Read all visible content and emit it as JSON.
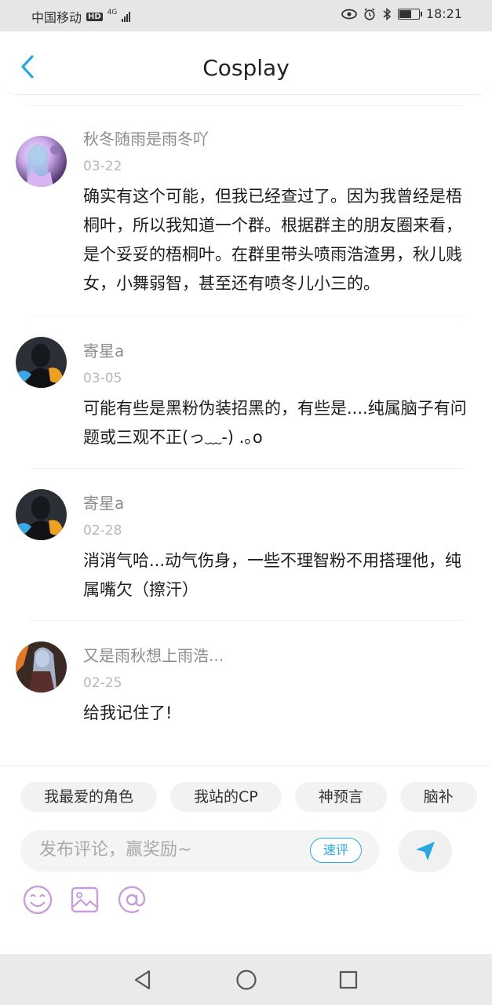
{
  "status_bar": {
    "carrier": "中国移动",
    "network_badge": "HD",
    "network_type": "4G",
    "time": "18:21",
    "battery_level": 0.6,
    "icons": [
      "eye-icon",
      "alarm-icon",
      "bluetooth-icon",
      "battery-icon"
    ]
  },
  "header": {
    "title": "Cosplay",
    "back_icon": "chevron-left-icon"
  },
  "comments": [
    {
      "user": "秋冬随雨是雨冬吖",
      "date": "03-22",
      "text": "确实有这个可能，但我已经查过了。因为我曾经是梧桐叶，所以我知道一个群。根据群主的朋友圈来看，是个妥妥的梧桐叶。在群里带头喷雨浩渣男，秋儿贱女，小舞弱智，甚至还有喷冬儿小三的。"
    },
    {
      "user": "寄星a",
      "date": "03-05",
      "text": "可能有些是黑粉伪装招黑的，有些是....纯属脑子有问题或三观不正(っ﹏-) .｡o"
    },
    {
      "user": "寄星a",
      "date": "02-28",
      "text": "消消气哈...动气伤身，一些不理智粉不用搭理他，纯属嘴欠（擦汗）"
    },
    {
      "user": "又是雨秋想上雨浩...",
      "date": "02-25",
      "text": "给我记住了!"
    }
  ],
  "composer": {
    "chips": [
      "我最爱的角色",
      "我站的CP",
      "神预言",
      "脑补"
    ],
    "placeholder": "发布评论，赢奖励~",
    "quick_comment_label": "速评",
    "send_icon": "send-icon",
    "tools": [
      "emoji-icon",
      "image-icon",
      "at-icon"
    ],
    "accent_color": "#2aa8e0",
    "tool_color": "#c79de0"
  },
  "nav_bar": {
    "buttons": [
      "back-triangle-icon",
      "home-circle-icon",
      "recents-square-icon"
    ]
  }
}
